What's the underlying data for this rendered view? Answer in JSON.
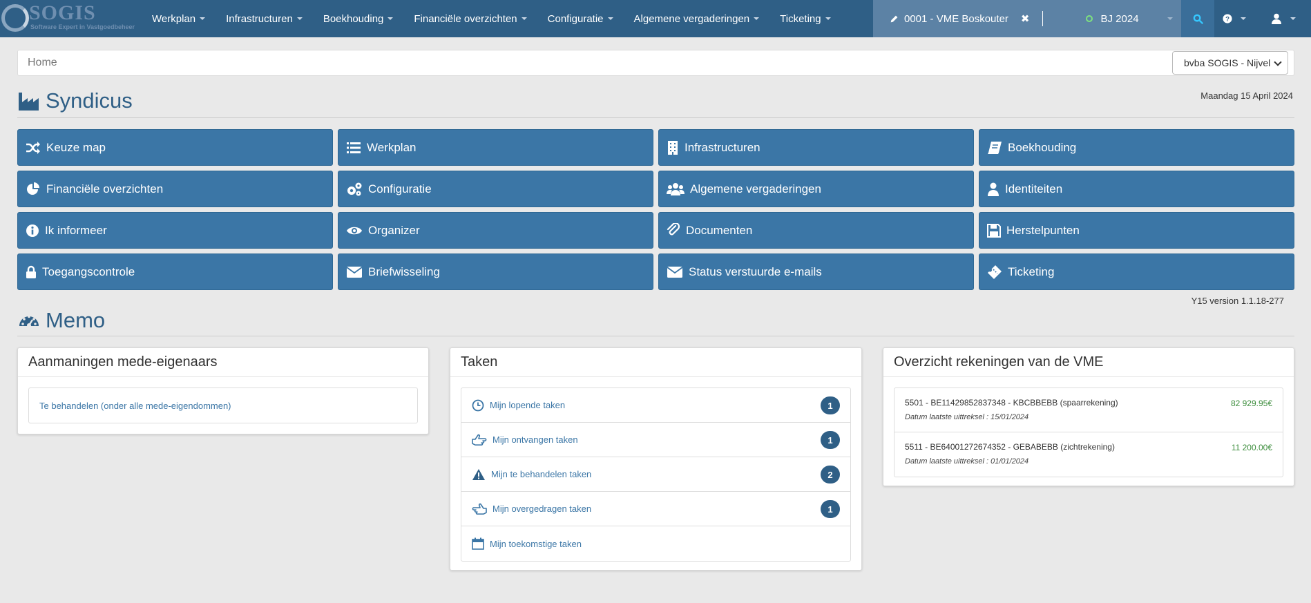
{
  "brand": {
    "name": "SOGIS",
    "tagline": "Software Expert in Vastgoedbeheer"
  },
  "nav": {
    "items": [
      {
        "label": "Werkplan"
      },
      {
        "label": "Infrastructuren"
      },
      {
        "label": "Boekhouding"
      },
      {
        "label": "Financiële overzichten"
      },
      {
        "label": "Configuratie"
      },
      {
        "label": "Algemene vergaderingen"
      },
      {
        "label": "Ticketing"
      }
    ],
    "dossier": "0001 - VME Boskouter",
    "fiscal_year": "BJ 2024",
    "icons": {
      "search": "search-icon",
      "help": "question-icon",
      "user": "user-icon"
    }
  },
  "breadcrumb": {
    "home": "Home"
  },
  "company_select": {
    "value": "bvba SOGIS - Nijvel"
  },
  "syndicus": {
    "title": "Syndicus",
    "date": "Maandag 15 April 2024",
    "tiles": [
      {
        "label": "Keuze map",
        "icon": "shuffle-icon"
      },
      {
        "label": "Werkplan",
        "icon": "list-icon"
      },
      {
        "label": "Infrastructuren",
        "icon": "building-icon"
      },
      {
        "label": "Boekhouding",
        "icon": "book-icon"
      },
      {
        "label": "Financiële overzichten",
        "icon": "pie-chart-icon"
      },
      {
        "label": "Configuratie",
        "icon": "gears-icon"
      },
      {
        "label": "Algemene vergaderingen",
        "icon": "users-icon"
      },
      {
        "label": "Identiteiten",
        "icon": "user-icon"
      },
      {
        "label": "Ik informeer",
        "icon": "info-icon"
      },
      {
        "label": "Organizer",
        "icon": "eye-icon"
      },
      {
        "label": "Documenten",
        "icon": "paperclip-icon"
      },
      {
        "label": "Herstelpunten",
        "icon": "save-icon"
      },
      {
        "label": "Toegangscontrole",
        "icon": "lock-icon"
      },
      {
        "label": "Briefwisseling",
        "icon": "envelope-icon"
      },
      {
        "label": "Status verstuurde e-mails",
        "icon": "envelope-icon"
      },
      {
        "label": "Ticketing",
        "icon": "ticket-icon"
      }
    ],
    "version": "Y15 version 1.1.18-277"
  },
  "memo": {
    "title": "Memo",
    "reminders": {
      "title": "Aanmaningen mede-eigenaars",
      "item": "Te behandelen (onder alle mede-eigendommen)"
    },
    "tasks": {
      "title": "Taken",
      "items": [
        {
          "label": "Mijn lopende taken",
          "count": "1",
          "icon": "clock-icon"
        },
        {
          "label": "Mijn ontvangen taken",
          "count": "1",
          "icon": "hand-right-icon"
        },
        {
          "label": "Mijn te behandelen taken",
          "count": "2",
          "icon": "warning-icon"
        },
        {
          "label": "Mijn overgedragen taken",
          "count": "1",
          "icon": "hand-left-icon"
        },
        {
          "label": "Mijn toekomstige taken",
          "count": "",
          "icon": "calendar-icon"
        }
      ]
    },
    "accounts": {
      "title": "Overzicht rekeningen van de VME",
      "items": [
        {
          "name": "5501 - BE11429852837348 - KBCBBEBB (spaarrekening)",
          "date": "Datum laatste uittreksel : 15/01/2024",
          "amount": "82 929.95€"
        },
        {
          "name": "5511 - BE64001272674352 - GEBABEBB (zichtrekening)",
          "date": "Datum laatste uittreksel : 01/01/2024",
          "amount": "11 200.00€"
        }
      ]
    }
  }
}
